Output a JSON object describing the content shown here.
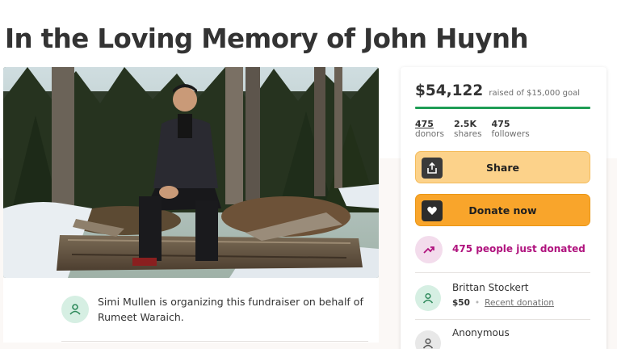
{
  "page": {
    "title": "In the Loving Memory of John Huynh"
  },
  "hero": {
    "image_alt": "photo-of-man-seated-on-log-in-snowy-forest"
  },
  "organizer": {
    "text": "Simi Mullen is organizing this fundraiser on behalf of Rumeet Waraich.",
    "icon": "person-group-icon"
  },
  "donation_card": {
    "amount_raised": "$54,122",
    "goal_text": "raised of $15,000 goal",
    "progress_fraction": 1.0,
    "stats": [
      {
        "value": "475",
        "label": "donors",
        "underlined": true
      },
      {
        "value": "2.5K",
        "label": "shares",
        "underlined": false
      },
      {
        "value": "475",
        "label": "followers",
        "underlined": false
      }
    ],
    "share_button": {
      "label": "Share",
      "icon": "share-upload-icon"
    },
    "donate_button": {
      "label": "Donate now",
      "icon": "gofundme-heart-icon"
    },
    "trending": {
      "text": "475 people just donated",
      "icon": "trending-up-icon"
    },
    "donations": [
      {
        "name": "Brittan Stockert",
        "amount": "$50",
        "tag": "Recent donation"
      },
      {
        "name": "Anonymous",
        "amount": "",
        "tag": ""
      }
    ]
  },
  "colors": {
    "progress": "#1f9d55",
    "share_button": "#fcd28a",
    "donate_button": "#f9a52b",
    "trending_text": "#b0137e",
    "avatar_green": "#d6efe3"
  }
}
